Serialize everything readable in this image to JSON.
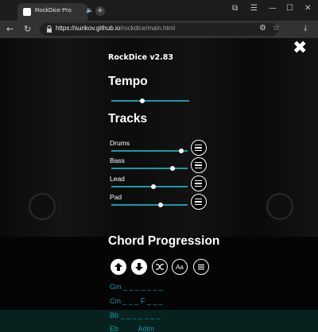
{
  "browser": {
    "tab_title": "RockDice Pro",
    "tab_audio_icon": "speaker-icon",
    "tab_close_glyph": "✕",
    "newtab_glyph": "+",
    "url_domain": "https://surikov.github.io",
    "url_path": "/rockdice/main.html",
    "back_glyph": "←",
    "reload_glyph": "↻",
    "min_glyph": "—",
    "max_glyph": "☐",
    "close_glyph": "✕"
  },
  "app": {
    "title": "RockDice v2.83",
    "close_glyph": "✖",
    "tempo": {
      "heading": "Tempo",
      "value": 0.4
    },
    "tracks": {
      "heading": "Tracks",
      "items": [
        {
          "label": "Drums",
          "volume": 0.92
        },
        {
          "label": "Bass",
          "volume": 0.8
        },
        {
          "label": "Lead",
          "volume": 0.55
        },
        {
          "label": "Pad",
          "volume": 0.65
        }
      ]
    },
    "chords": {
      "heading": "Chord Progression",
      "buttons": [
        {
          "name": "move-up-button",
          "icon": "arrow-up-icon"
        },
        {
          "name": "move-down-button",
          "icon": "arrow-down-icon"
        },
        {
          "name": "shuffle-button",
          "icon": "shuffle-icon"
        },
        {
          "name": "text-mode-button",
          "icon": "text-icon",
          "label": "Aa"
        },
        {
          "name": "chord-menu-button",
          "icon": "menu-icon"
        }
      ],
      "lines": [
        "Gm _ _ _ _ _ _ _",
        "Cm _ _ _ F _ _ _",
        "Bb _ _ _ _ _ _ _",
        "Eb _ _ _ Adim _ _"
      ]
    },
    "colors": {
      "accent": "#1b9aa8"
    }
  }
}
